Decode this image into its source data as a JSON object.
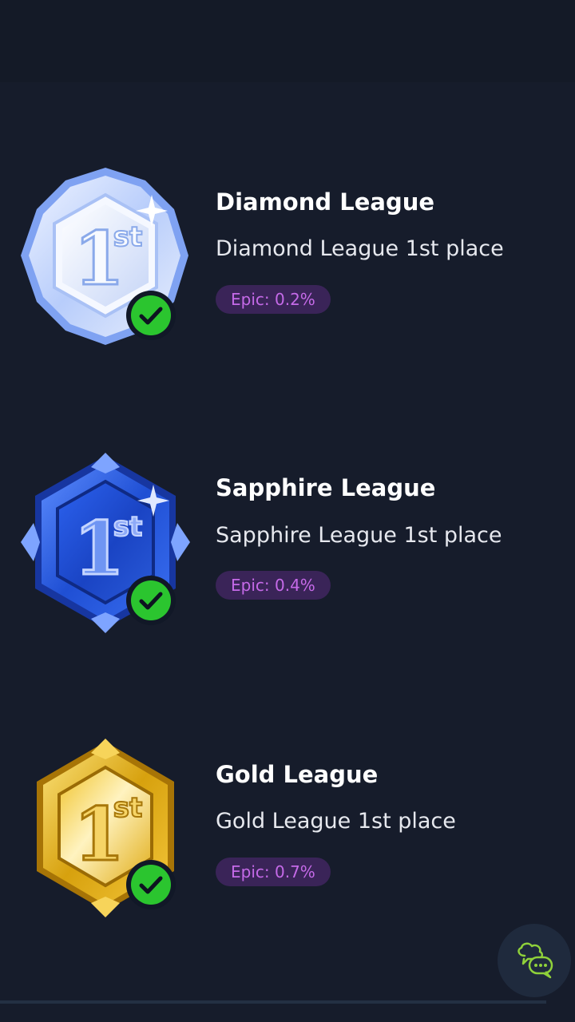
{
  "achievements": [
    {
      "title": "Diamond League",
      "description": "Diamond League 1st place",
      "rarity": "Epic: 0.2%",
      "badge_rank": "1",
      "badge_suffix": "st",
      "badge_color": "#d9e5ff",
      "completed": true
    },
    {
      "title": "Sapphire League",
      "description": "Sapphire League 1st place",
      "rarity": "Epic: 0.4%",
      "badge_rank": "1",
      "badge_suffix": "st",
      "badge_color": "#2f5fe0",
      "completed": true
    },
    {
      "title": "Gold League",
      "description": "Gold League 1st place",
      "rarity": "Epic: 0.7%",
      "badge_rank": "1",
      "badge_suffix": "st",
      "badge_color": "#e3b21c",
      "completed": true
    }
  ],
  "colors": {
    "background": "#161c2b",
    "rarity_pill_bg": "#3a2458",
    "rarity_pill_text": "#c56ae8",
    "check_green": "#2bc52f",
    "chat_icon": "#8fd13a"
  },
  "chat_button": {
    "icon": "chat-bubbles-icon"
  }
}
